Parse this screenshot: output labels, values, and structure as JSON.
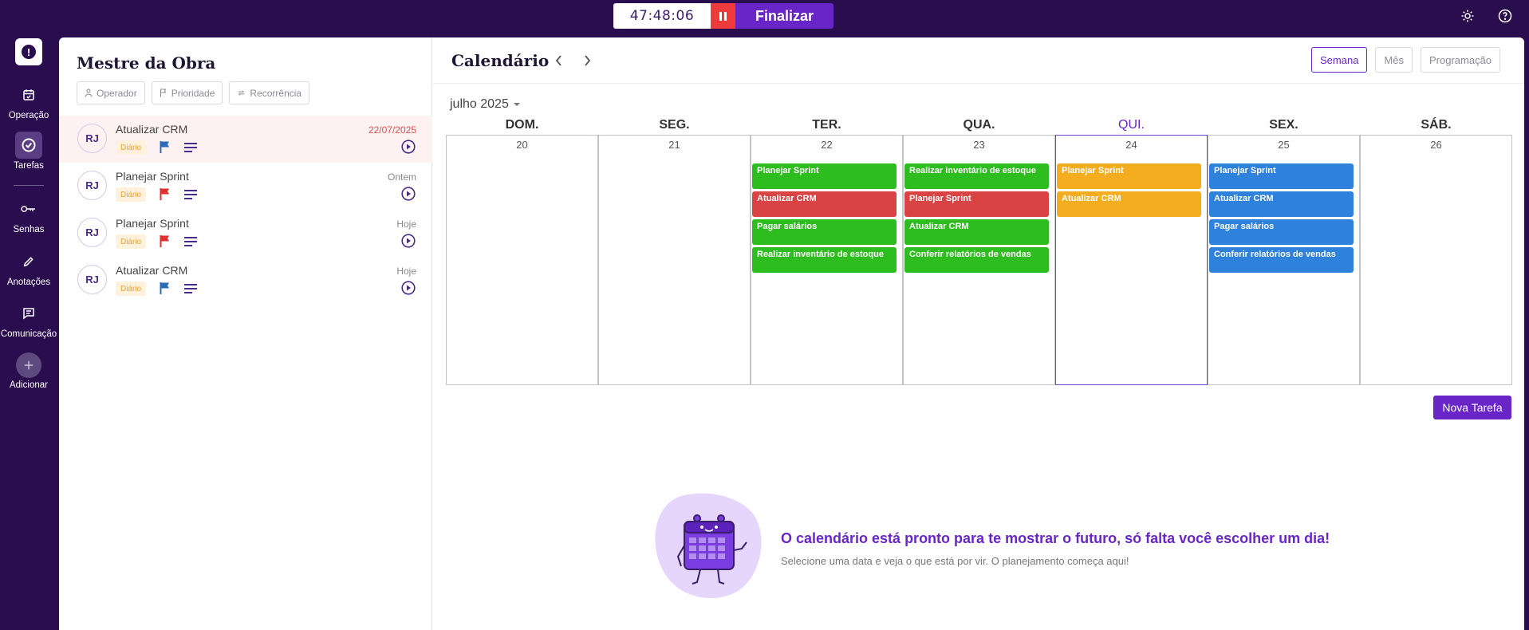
{
  "topbar": {
    "timer": "47:48:06",
    "finalize_label": "Finalizar"
  },
  "nav": {
    "items": [
      {
        "label": "Operação",
        "icon": "calendar-check-icon"
      },
      {
        "label": "Tarefas",
        "icon": "check-circle-icon"
      },
      {
        "label": "Senhas",
        "icon": "key-icon"
      },
      {
        "label": "Anotações",
        "icon": "pencil-icon"
      },
      {
        "label": "Comunicação",
        "icon": "message-icon"
      },
      {
        "label": "Adicionar",
        "icon": "plus-icon"
      }
    ]
  },
  "tasks": {
    "title": "Mestre da Obra",
    "filters": [
      "Operador",
      "Prioridade",
      "Recorrência"
    ],
    "items": [
      {
        "initials": "RJ",
        "name": "Atualizar CRM",
        "date": "22/07/2025",
        "badge": "Diário",
        "flag_color": "#2b6cb8"
      },
      {
        "initials": "RJ",
        "name": "Planejar Sprint",
        "date": "Ontem",
        "badge": "Diário",
        "flag_color": "#e0302f"
      },
      {
        "initials": "RJ",
        "name": "Planejar Sprint",
        "date": "Hoje",
        "badge": "Diário",
        "flag_color": "#e0302f"
      },
      {
        "initials": "RJ",
        "name": "Atualizar CRM",
        "date": "Hoje",
        "badge": "Diário",
        "flag_color": "#2b6cb8"
      }
    ]
  },
  "calendar": {
    "title": "Calendário",
    "views": [
      "Semana",
      "Mês",
      "Programação"
    ],
    "active_view": "Semana",
    "month_label": "julho 2025",
    "days": [
      {
        "dow": "DOM.",
        "num": "20",
        "events": []
      },
      {
        "dow": "SEG.",
        "num": "21",
        "events": []
      },
      {
        "dow": "TER.",
        "num": "22",
        "events": [
          {
            "label": "Planejar Sprint",
            "color": "#2ebd1e"
          },
          {
            "label": "Atualizar CRM",
            "color": "#d94343"
          },
          {
            "label": "Pagar salários",
            "color": "#2ebd1e"
          },
          {
            "label": "Realizar inventário de estoque",
            "color": "#2ebd1e"
          }
        ]
      },
      {
        "dow": "QUA.",
        "num": "23",
        "events": [
          {
            "label": "Realizar inventário de estoque",
            "color": "#2ebd1e"
          },
          {
            "label": "Planejar Sprint",
            "color": "#d94343"
          },
          {
            "label": "Atualizar CRM",
            "color": "#2ebd1e"
          },
          {
            "label": "Conferir relatórios de vendas",
            "color": "#2ebd1e"
          }
        ]
      },
      {
        "dow": "QUI.",
        "num": "24",
        "today": true,
        "events": [
          {
            "label": "Planejar Sprint",
            "color": "#f4ad1f"
          },
          {
            "label": "Atualizar CRM",
            "color": "#f4ad1f"
          }
        ]
      },
      {
        "dow": "SEX.",
        "num": "25",
        "events": [
          {
            "label": "Planejar Sprint",
            "color": "#2f82db"
          },
          {
            "label": "Atualizar CRM",
            "color": "#2f82db"
          },
          {
            "label": "Pagar salários",
            "color": "#2f82db"
          },
          {
            "label": "Conferir relatórios de vendas",
            "color": "#2f82db"
          }
        ]
      },
      {
        "dow": "SÁB.",
        "num": "26",
        "events": []
      }
    ],
    "new_task_label": "Nova Tarefa"
  },
  "empty_state": {
    "title": "O calendário está pronto para te mostrar o futuro, só falta você escolher um dia!",
    "subtitle": "Selecione uma data e veja o que está por vir. O planejamento começa aqui!"
  },
  "colors": {
    "brand": "#6a25c9",
    "sidebar": "#2a0d4e",
    "danger": "#ef3b3b"
  }
}
